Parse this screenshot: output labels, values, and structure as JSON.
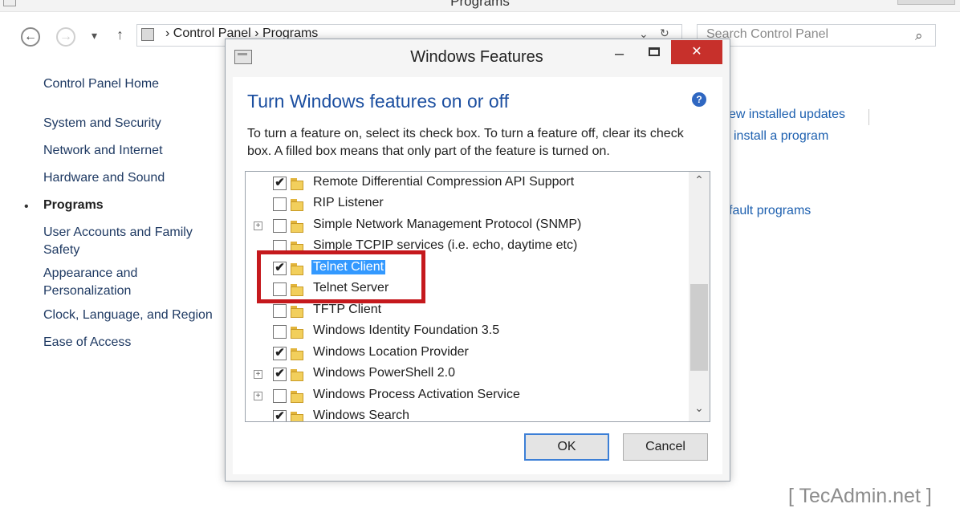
{
  "window": {
    "title": "Programs"
  },
  "addressbar": {
    "path": "› Control Panel › Programs",
    "dropdown": "⌄",
    "refresh": "↻"
  },
  "search": {
    "placeholder": "Search Control Panel"
  },
  "nav": {
    "back": "←",
    "forward": "→",
    "recent": "▾",
    "up": "↑"
  },
  "sidebar": {
    "items": [
      {
        "label": "Control Panel Home"
      },
      {
        "label": "System and Security"
      },
      {
        "label": "Network and Internet"
      },
      {
        "label": "Hardware and Sound"
      },
      {
        "label": "Programs"
      },
      {
        "label": "User Accounts and Family Safety"
      },
      {
        "label": "Appearance and Personalization"
      },
      {
        "label": "Clock, Language, and Region"
      },
      {
        "label": "Ease of Access"
      }
    ],
    "current": "Programs"
  },
  "content": {
    "links": [
      "ew installed updates",
      "install a program",
      "fault programs"
    ]
  },
  "dialog": {
    "title": "Windows Features",
    "minimize": "–",
    "close": "✕",
    "heading": "Turn Windows features on or off",
    "help": "?",
    "description": "To turn a feature on, select its check box. To turn a feature off, clear its check box. A filled box means that only part of the feature is turned on.",
    "features": [
      {
        "label": "Remote Differential Compression API Support",
        "checked": true,
        "expandable": false
      },
      {
        "label": "RIP Listener",
        "checked": false,
        "expandable": false
      },
      {
        "label": "Simple Network Management Protocol (SNMP)",
        "checked": false,
        "expandable": true
      },
      {
        "label": "Simple TCPIP services (i.e. echo, daytime etc)",
        "checked": false,
        "expandable": false
      },
      {
        "label": "Telnet Client",
        "checked": true,
        "expandable": false,
        "selected": true
      },
      {
        "label": "Telnet Server",
        "checked": false,
        "expandable": false
      },
      {
        "label": "TFTP Client",
        "checked": false,
        "expandable": false
      },
      {
        "label": "Windows Identity Foundation 3.5",
        "checked": false,
        "expandable": false
      },
      {
        "label": "Windows Location Provider",
        "checked": true,
        "expandable": false
      },
      {
        "label": "Windows PowerShell 2.0",
        "checked": true,
        "expandable": true
      },
      {
        "label": "Windows Process Activation Service",
        "checked": false,
        "expandable": true
      },
      {
        "label": "Windows Search",
        "checked": true,
        "expandable": false
      }
    ],
    "check_mark": "✔",
    "expand_mark": "+",
    "scroll_up": "⌃",
    "scroll_down": "⌄",
    "ok_label": "OK",
    "cancel_label": "Cancel"
  },
  "watermark": "[ TecAdmin.net ]",
  "colors": {
    "heading": "#1c4fa0",
    "link": "#1c5faf",
    "close_button": "#c7302b",
    "selection": "#3399ff",
    "highlight_box": "#c5191d"
  }
}
